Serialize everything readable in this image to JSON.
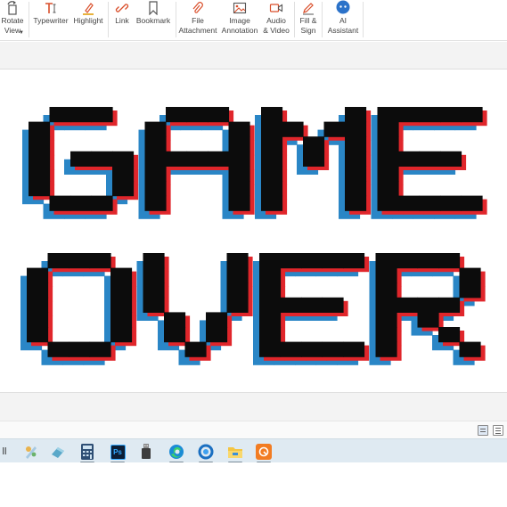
{
  "ribbon": {
    "tools": [
      {
        "id": "rotate-view",
        "label": "Rotate\nView",
        "icon": "rotate-page-icon",
        "dropdown": true
      },
      {
        "id": "typewriter",
        "label": "Typewriter",
        "icon": "typewriter-icon"
      },
      {
        "id": "highlight",
        "label": "Highlight",
        "icon": "highlighter-icon"
      },
      {
        "id": "link",
        "label": "Link",
        "icon": "link-icon"
      },
      {
        "id": "bookmark",
        "label": "Bookmark",
        "icon": "bookmark-icon"
      },
      {
        "id": "file-attachment",
        "label": "File\nAttachment",
        "icon": "paperclip-icon"
      },
      {
        "id": "image-annotation",
        "label": "Image\nAnnotation",
        "icon": "image-icon"
      },
      {
        "id": "audio-video",
        "label": "Audio\n& Video",
        "icon": "video-camera-icon"
      },
      {
        "id": "fill-sign",
        "label": "Fill &\nSign",
        "icon": "pen-icon"
      },
      {
        "id": "ai-assistant",
        "label": "AI\nAssistant",
        "icon": "ai-assistant-icon"
      }
    ]
  },
  "document": {
    "image_text": [
      "GAME",
      "OVER"
    ],
    "colors": {
      "fill": "#0c0c0c",
      "shadow_red": "#e0262b",
      "shadow_blue": "#2a86c6"
    }
  },
  "statusbar": {
    "view_buttons": [
      "single-page-view-icon",
      "continuous-view-icon"
    ]
  },
  "taskbar": {
    "items": [
      {
        "name": "pinned-app-icon",
        "glyph": "ll"
      },
      {
        "name": "paint-icon"
      },
      {
        "name": "eraser-app-icon"
      },
      {
        "name": "calculator-icon"
      },
      {
        "name": "photoshop-icon",
        "text": "Ps"
      },
      {
        "name": "usb-drive-icon"
      },
      {
        "name": "edge-browser-icon"
      },
      {
        "name": "circle-app-icon"
      },
      {
        "name": "file-explorer-icon"
      },
      {
        "name": "pdf-reader-icon"
      }
    ]
  },
  "theme": {
    "accent": "#2b72c9",
    "ribbon_icon": "#d94e2a"
  }
}
